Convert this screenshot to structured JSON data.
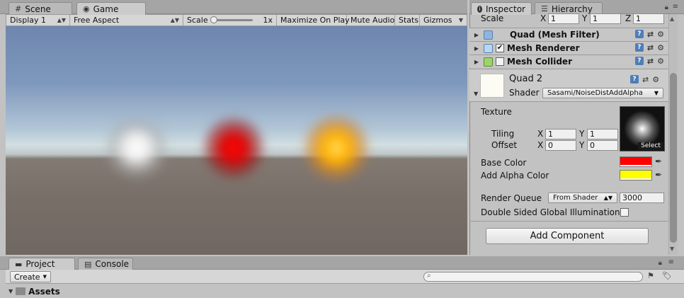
{
  "scene_tabs": [
    {
      "icon": "#",
      "label": "Scene"
    },
    {
      "icon": "◉",
      "label": "Game"
    }
  ],
  "game_toolbar": {
    "display": "Display 1",
    "aspect": "Free Aspect",
    "scale_label": "Scale",
    "scale_value": "1x",
    "maximize": "Maximize On Play",
    "mute": "Mute Audio",
    "stats": "Stats",
    "gizmos": "Gizmos"
  },
  "inspector_tabs": [
    {
      "icon": "i",
      "label": "Inspector"
    },
    {
      "icon": "☰",
      "label": "Hierarchy"
    }
  ],
  "transform_scale": {
    "label": "Scale",
    "x": "1",
    "y": "1",
    "z": "1"
  },
  "components": [
    {
      "name": "Quad (Mesh Filter)",
      "checkbox": false,
      "checked": false
    },
    {
      "name": "Mesh Renderer",
      "checkbox": true,
      "checked": true
    },
    {
      "name": "Mesh Collider",
      "checkbox": true,
      "checked": false
    }
  ],
  "material": {
    "name": "Quad 2",
    "shader_label": "Shader",
    "shader_value": "Sasami/NoiseDistAddAlpha",
    "texture_label": "Texture",
    "tiling_label": "Tiling",
    "tiling": {
      "x": "1",
      "y": "1"
    },
    "offset_label": "Offset",
    "offset": {
      "x": "0",
      "y": "0"
    },
    "select_label": "Select",
    "base_color_label": "Base Color",
    "base_color": "#ff0000",
    "add_alpha_label": "Add Alpha Color",
    "add_alpha_color": "#ffff00",
    "render_queue_label": "Render Queue",
    "render_queue_mode": "From Shader",
    "render_queue_value": "3000",
    "double_sided_label": "Double Sided Global Illumination"
  },
  "add_component": "Add Component",
  "bottom_tabs": [
    {
      "icon": "▬",
      "label": "Project"
    },
    {
      "icon": "▤",
      "label": "Console"
    }
  ],
  "project_toolbar": {
    "create": "Create"
  },
  "assets_label": "Assets",
  "orbs": [
    {
      "name": "white-orb",
      "color": "#ffffff"
    },
    {
      "name": "red-orb",
      "color": "#ff1010"
    },
    {
      "name": "orange-orb",
      "color": "#ffb000"
    }
  ]
}
